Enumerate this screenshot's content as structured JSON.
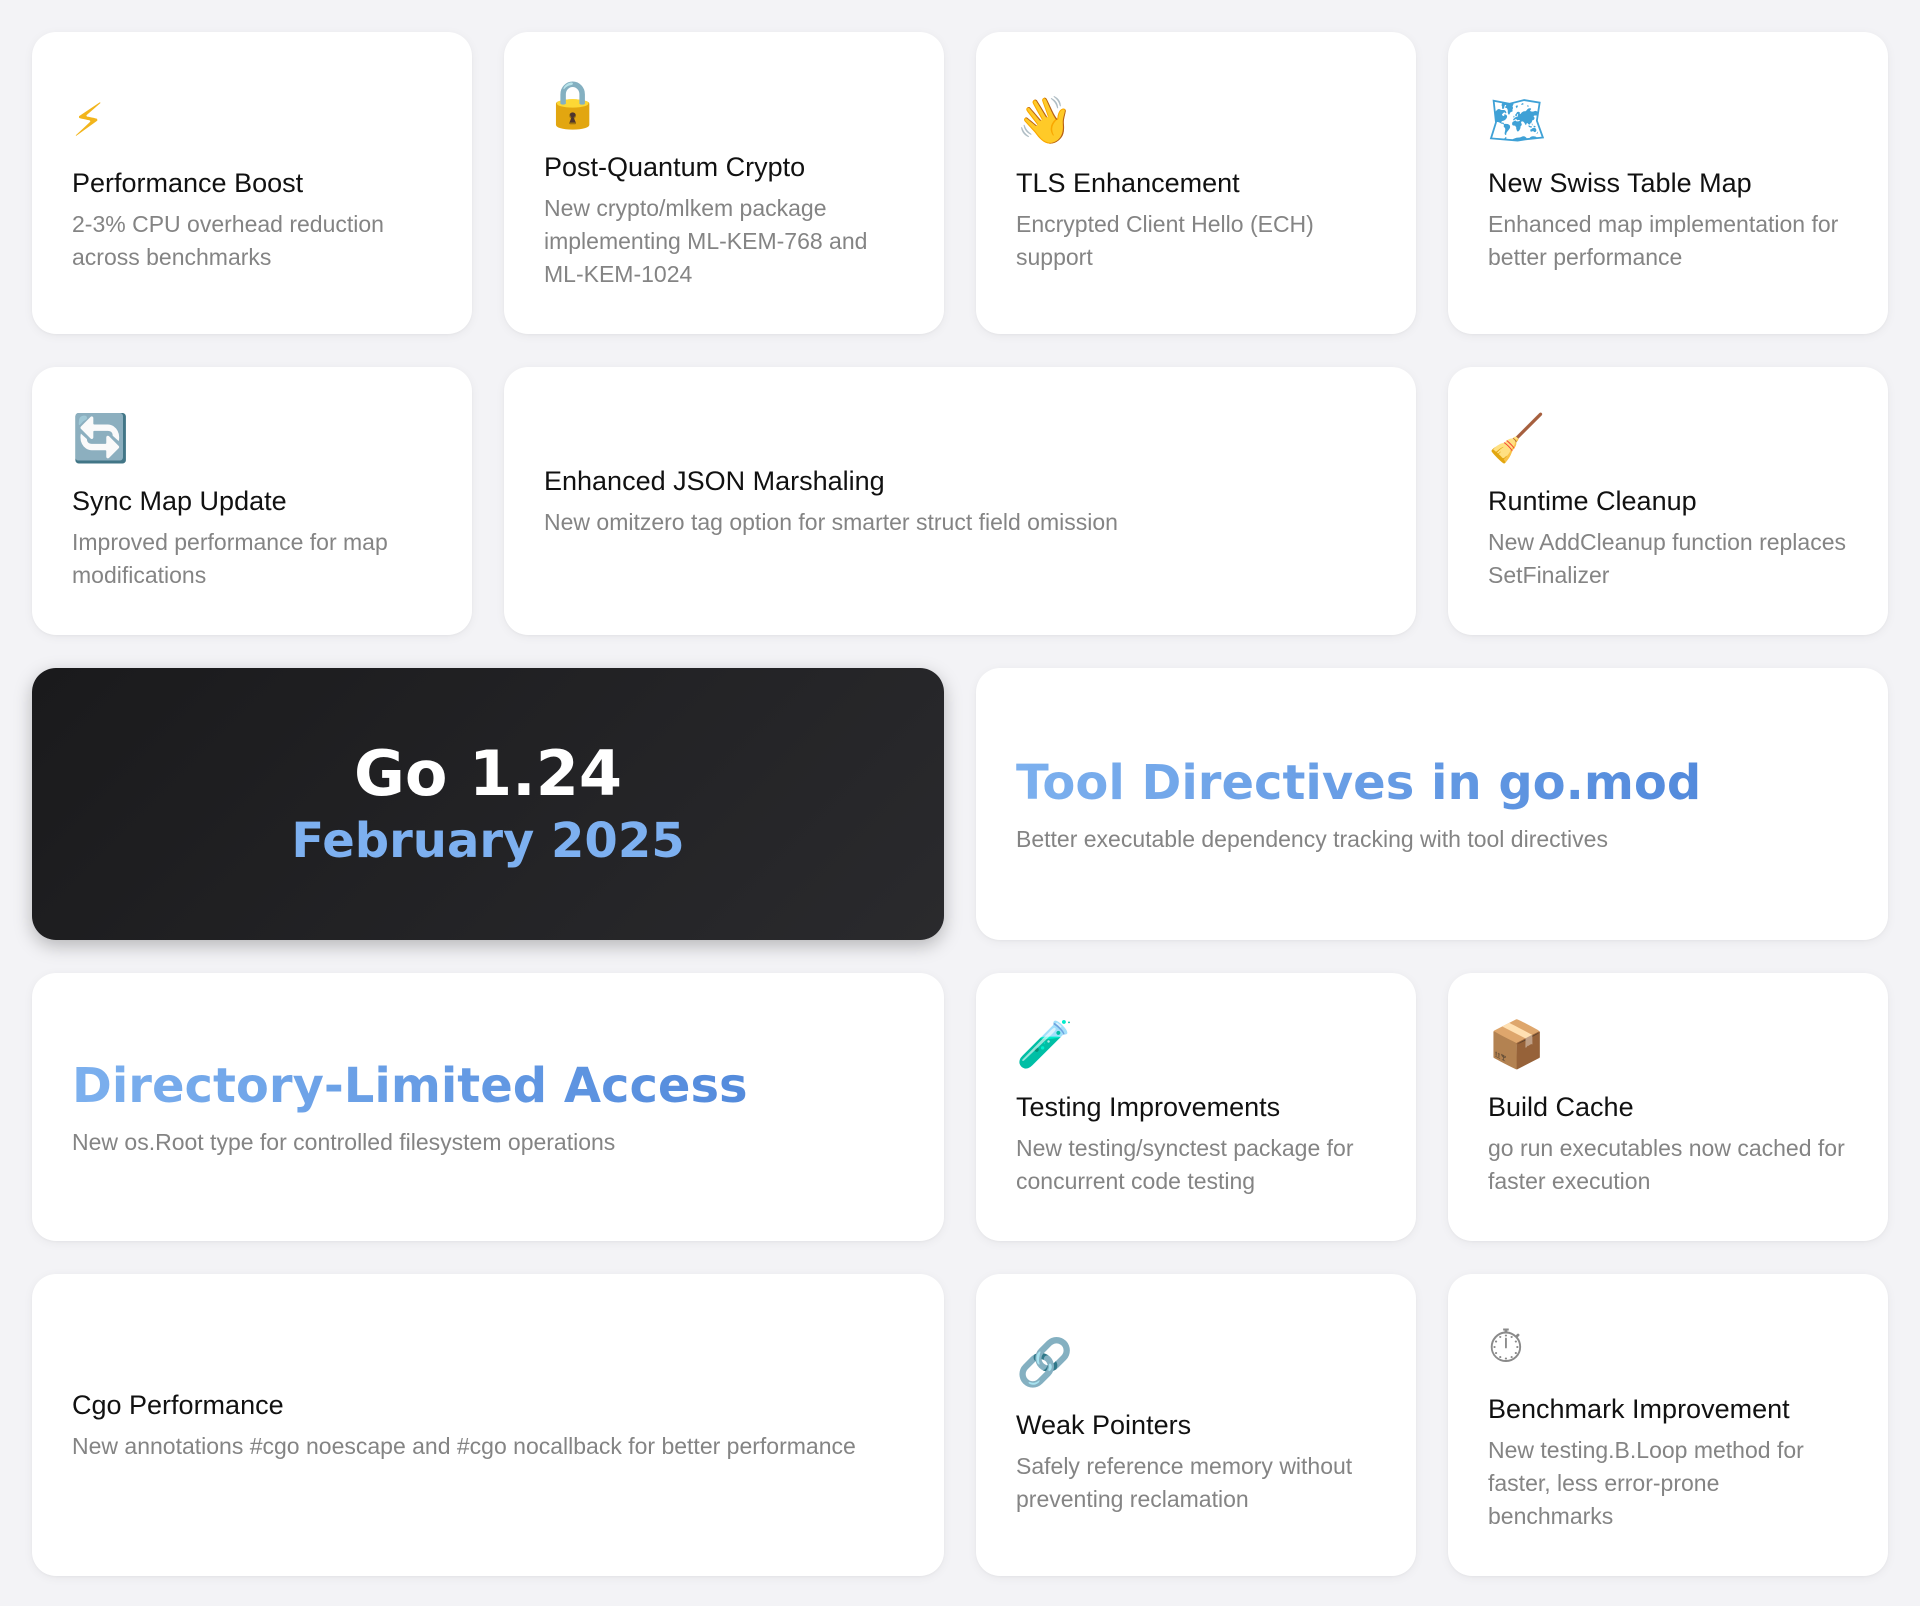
{
  "cards": {
    "performance": {
      "icon": "lightning-icon",
      "glyph": "⚡",
      "title": "Performance Boost",
      "desc": "2-3% CPU overhead reduction across benchmarks"
    },
    "crypto": {
      "icon": "lock-icon",
      "glyph": "🔒",
      "title": "Post-Quantum Crypto",
      "desc": "New crypto/mlkem package implementing ML-KEM-768 and ML-KEM-1024"
    },
    "tls": {
      "icon": "waving-hand-icon",
      "glyph": "👋",
      "title": "TLS Enhancement",
      "desc": "Encrypted Client Hello (ECH) support"
    },
    "swiss": {
      "icon": "world-map-icon",
      "glyph": "🗺",
      "title": "New Swiss Table Map",
      "desc": "Enhanced map implementation for better performance"
    },
    "syncmap": {
      "icon": "sync-arrows-icon",
      "glyph": "🔄",
      "title": "Sync Map Update",
      "desc": "Improved performance for map modifications"
    },
    "json": {
      "title": "Enhanced JSON Marshaling",
      "desc": "New omitzero tag option for smarter struct field omission"
    },
    "cleanup": {
      "icon": "broom-icon",
      "glyph": "🧹",
      "title": "Runtime Cleanup",
      "desc": "New AddCleanup function replaces SetFinalizer"
    },
    "tooldirectives": {
      "title": "Tool Directives in go.mod",
      "desc": "Better executable dependency tracking with tool directives"
    },
    "dirlimited": {
      "title": "Directory-Limited Access",
      "desc": "New os.Root type for controlled filesystem operations"
    },
    "testing": {
      "icon": "test-tube-icon",
      "glyph": "🧪",
      "title": "Testing Improvements",
      "desc": "New testing/synctest package for concurrent code testing"
    },
    "buildcache": {
      "icon": "package-icon",
      "glyph": "📦",
      "title": "Build Cache",
      "desc": "go run executables now cached for faster execution"
    },
    "cgo": {
      "title": "Cgo Performance",
      "desc": "New annotations #cgo noescape and #cgo nocallback for better performance"
    },
    "weak": {
      "icon": "link-icon",
      "glyph": "🔗",
      "title": "Weak Pointers",
      "desc": "Safely reference memory without preventing reclamation"
    },
    "benchmark": {
      "icon": "stopwatch-icon",
      "glyph": "⏱",
      "title": "Benchmark Improvement",
      "desc": "New testing.B.Loop method for faster, less error-prone benchmarks"
    }
  },
  "hero": {
    "version": "Go 1.24",
    "date": "February 2025"
  },
  "colors": {
    "background": "#f3f3f6",
    "card": "#ffffff",
    "hero_bg": "#1c1c1e",
    "accent": "#7db0f0",
    "gradient_start": "#7cb0ee",
    "gradient_end": "#4a82d8"
  }
}
